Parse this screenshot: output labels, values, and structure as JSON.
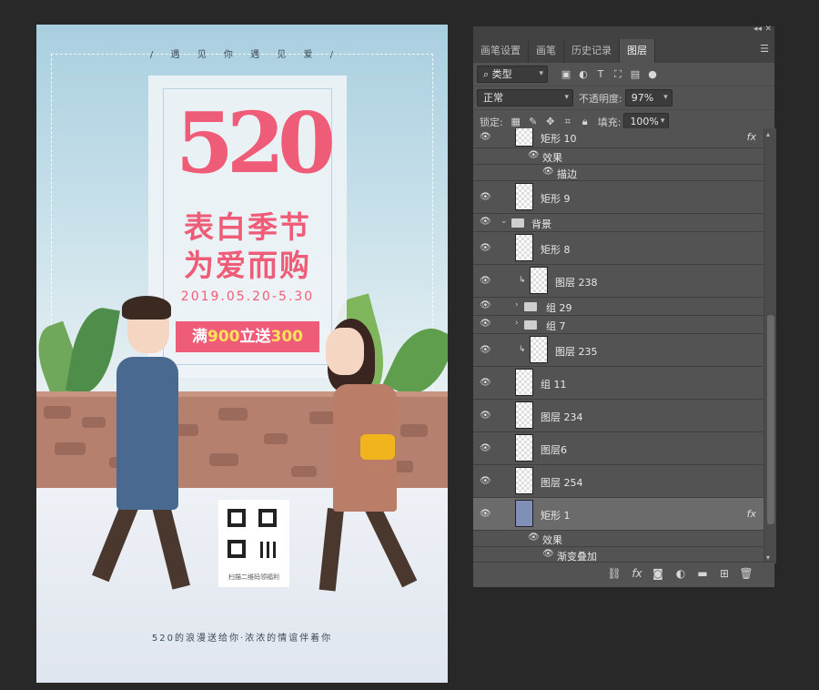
{
  "poster": {
    "top_text": "/ 遇 见 你 遇 见 爱 /",
    "headline_number": "520",
    "slogan_line1": "表白季节",
    "slogan_line2": "为爱而购",
    "date_range": "2019.05.20-5.30",
    "promo_prefix": "满",
    "promo_amount1": "900",
    "promo_middle": "立送",
    "promo_amount2": "300",
    "qr_caption": "扫描二维码领福利",
    "bottom_text": "520的浪漫送给你·浓浓的情谊伴着你",
    "colors": {
      "accent": "#ef5c78",
      "promo_highlight": "#ffe15a"
    }
  },
  "panel": {
    "tabs": [
      "画笔设置",
      "画笔",
      "历史记录",
      "图层"
    ],
    "active_tab": "图层",
    "filter_kind": "类型",
    "blend_mode": "正常",
    "opacity_label": "不透明度:",
    "opacity_value": "97%",
    "lock_label": "锁定:",
    "fill_label": "填充:",
    "fill_value": "100%",
    "layers": {
      "rect10": "矩形 10",
      "effect1": "效果",
      "stroke": "描边",
      "rect9": "矩形 9",
      "bg_group": "背景",
      "rect8": "矩形 8",
      "layer238": "图层 238",
      "group29": "组 29",
      "group7": "组 7",
      "layer235": "图层 235",
      "group11": "组 11",
      "layer234": "图层 234",
      "layer6": "图层6",
      "layer254": "图层 254",
      "rect1": "矩形 1",
      "effect2": "效果",
      "gradient": "渐变叠加",
      "fx": "fx"
    }
  }
}
